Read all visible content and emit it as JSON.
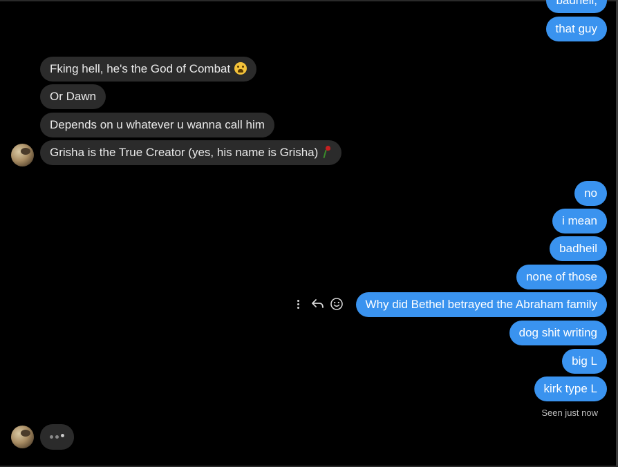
{
  "messages": {
    "out_top": [
      {
        "text": "badheil,"
      },
      {
        "text": "that guy"
      }
    ],
    "incoming": [
      {
        "text": "Fking hell, he's the God of Combat",
        "emoji": "loudly-crying-face-emoji"
      },
      {
        "text": "Or Dawn"
      },
      {
        "text": "Depends on u whatever u wanna call him"
      },
      {
        "text": "Grisha is the True Creator (yes, his name is Grisha)",
        "emoji": "wilted-rose-emoji"
      }
    ],
    "outgoing": [
      {
        "text": "no"
      },
      {
        "text": "i mean"
      },
      {
        "text": "badheil"
      },
      {
        "text": "none of those"
      },
      {
        "text": "Why did Bethel betrayed the Abraham family"
      },
      {
        "text": "dog shit writing"
      },
      {
        "text": "big L"
      },
      {
        "text": "kirk type L"
      }
    ]
  },
  "hover_actions": {
    "more_icon": "vertical-ellipsis-icon",
    "reply_icon": "reply-arrow-icon",
    "react_icon": "smiley-icon"
  },
  "status": {
    "seen": "Seen just now"
  },
  "typing_indicator": {
    "icon": "typing-dots-icon"
  },
  "colors": {
    "background": "#000000",
    "incoming_bubble": "#2b2b2b",
    "outgoing_bubble": "#3a93ef",
    "incoming_text": "#eaeaea",
    "outgoing_text": "#ffffff"
  }
}
